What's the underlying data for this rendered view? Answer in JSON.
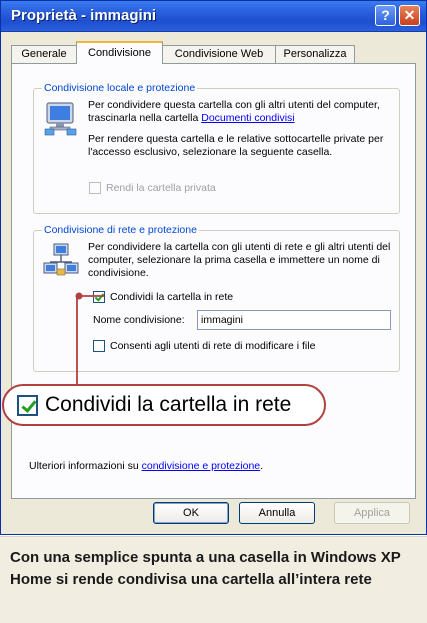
{
  "window": {
    "title": "Proprietà - immagini"
  },
  "tabs": [
    {
      "label": "Generale"
    },
    {
      "label": "Condivisione"
    },
    {
      "label": "Condivisione Web"
    },
    {
      "label": "Personalizza"
    }
  ],
  "local_sharing": {
    "legend": "Condivisione locale e protezione",
    "text1_prefix": "Per condividere questa cartella con gli altri utenti del computer, trascinarla nella cartella",
    "text1_link": "Documenti condivisi",
    "text2": "Per rendere questa cartella e le relative sottocartelle private per l'accesso esclusivo, selezionare la seguente casella.",
    "private_checkbox_label": "Rendi la cartella privata"
  },
  "network_sharing": {
    "legend": "Condivisione di rete e protezione",
    "text": "Per condividere la cartella con gli utenti di rete e gli altri utenti del computer, selezionare la prima casella e immettere un nome di condivisione.",
    "share_checkbox_label": "Condividi la cartella in rete",
    "share_name_label": "Nome condivisione:",
    "share_name_value": "immagini",
    "allow_modify_label": "Consenti agli utenti di rete di modificare i file"
  },
  "callout": {
    "label": "Condividi la cartella in rete"
  },
  "more_info": {
    "prefix": "Ulteriori informazioni su",
    "link": "condivisione e protezione",
    "suffix": "."
  },
  "buttons": {
    "ok": "OK",
    "cancel": "Annulla",
    "apply": "Applica"
  },
  "caption": "Con una semplice spunta a una casella in Windows XP Home si rende condivisa una cartella all’intera rete",
  "colors": {
    "titlebar": "#2a5fde",
    "callout_border": "#b0413e",
    "link": "#0000ff",
    "legend": "#0046d5"
  }
}
